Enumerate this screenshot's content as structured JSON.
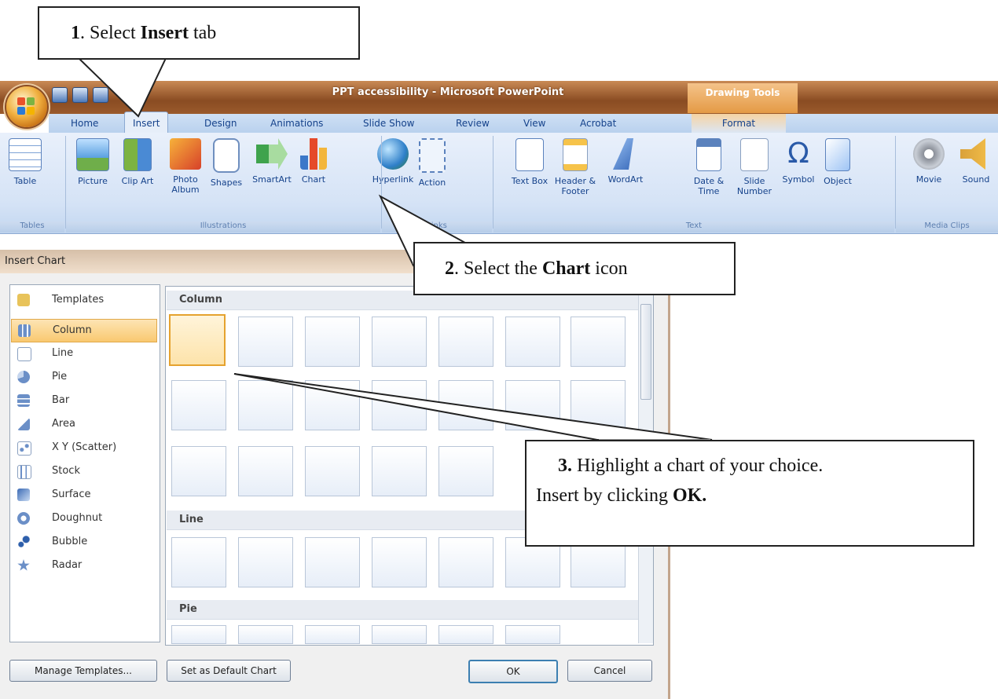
{
  "window": {
    "title": "PPT accessibility - Microsoft PowerPoint",
    "contextual_tab_group": "Drawing Tools"
  },
  "tabs": [
    "Home",
    "Insert",
    "Design",
    "Animations",
    "Slide Show",
    "Review",
    "View",
    "Acrobat",
    "Format"
  ],
  "active_tab": "Insert",
  "ribbon": {
    "groups": [
      {
        "label": "Tables",
        "items": [
          "Table"
        ]
      },
      {
        "label": "Illustrations",
        "items": [
          "Picture",
          "Clip Art",
          "Photo Album",
          "Shapes",
          "SmartArt",
          "Chart"
        ]
      },
      {
        "label": "Links",
        "items": [
          "Hyperlink",
          "Action"
        ]
      },
      {
        "label": "Text",
        "items": [
          "Text Box",
          "Header & Footer",
          "WordArt",
          "Date & Time",
          "Slide Number",
          "Symbol",
          "Object"
        ]
      },
      {
        "label": "Media Clips",
        "items": [
          "Movie",
          "Sound"
        ]
      }
    ],
    "item_labels": {
      "table": "Table",
      "picture": "Picture",
      "clip_art": "Clip Art",
      "photo_album": "Photo Album",
      "shapes": "Shapes",
      "smartart": "SmartArt",
      "chart": "Chart",
      "hyperlink": "Hyperlink",
      "action": "Action",
      "text_box": "Text Box",
      "header_footer": "Header & Footer",
      "wordart": "WordArt",
      "date_time": "Date & Time",
      "slide_number": "Slide Number",
      "symbol": "Symbol",
      "object": "Object",
      "movie": "Movie",
      "sound": "Sound"
    },
    "group_labels": {
      "tables": "Tables",
      "illustrations": "Illustrations",
      "links": "Links",
      "text": "Text",
      "media": "Media Clips"
    }
  },
  "dialog": {
    "title": "Insert Chart",
    "categories": [
      "Templates",
      "Column",
      "Line",
      "Pie",
      "Bar",
      "Area",
      "X Y (Scatter)",
      "Stock",
      "Surface",
      "Doughnut",
      "Bubble",
      "Radar"
    ],
    "selected_category": "Column",
    "sections": {
      "column": "Column",
      "line": "Line",
      "pie": "Pie"
    },
    "buttons": {
      "manage_templates": "Manage Templates...",
      "set_default": "Set as Default Chart",
      "ok": "OK",
      "cancel": "Cancel"
    }
  },
  "callouts": {
    "step1": {
      "num": "1",
      "pre": ". Select ",
      "bold": "Insert",
      "post": " tab"
    },
    "step2": {
      "num": "2",
      "pre": ". Select the ",
      "bold": "Chart",
      "post": " icon"
    },
    "step3": {
      "num": "3.",
      "line1": " Highlight a chart of your choice.",
      "line2_pre": "Insert by clicking ",
      "line2_bold": "OK."
    }
  },
  "colors": {
    "title_bar": "#8a4c22",
    "ribbon": "#d5e3f6",
    "selection": "#f9c970",
    "tab_text": "#15428b"
  }
}
